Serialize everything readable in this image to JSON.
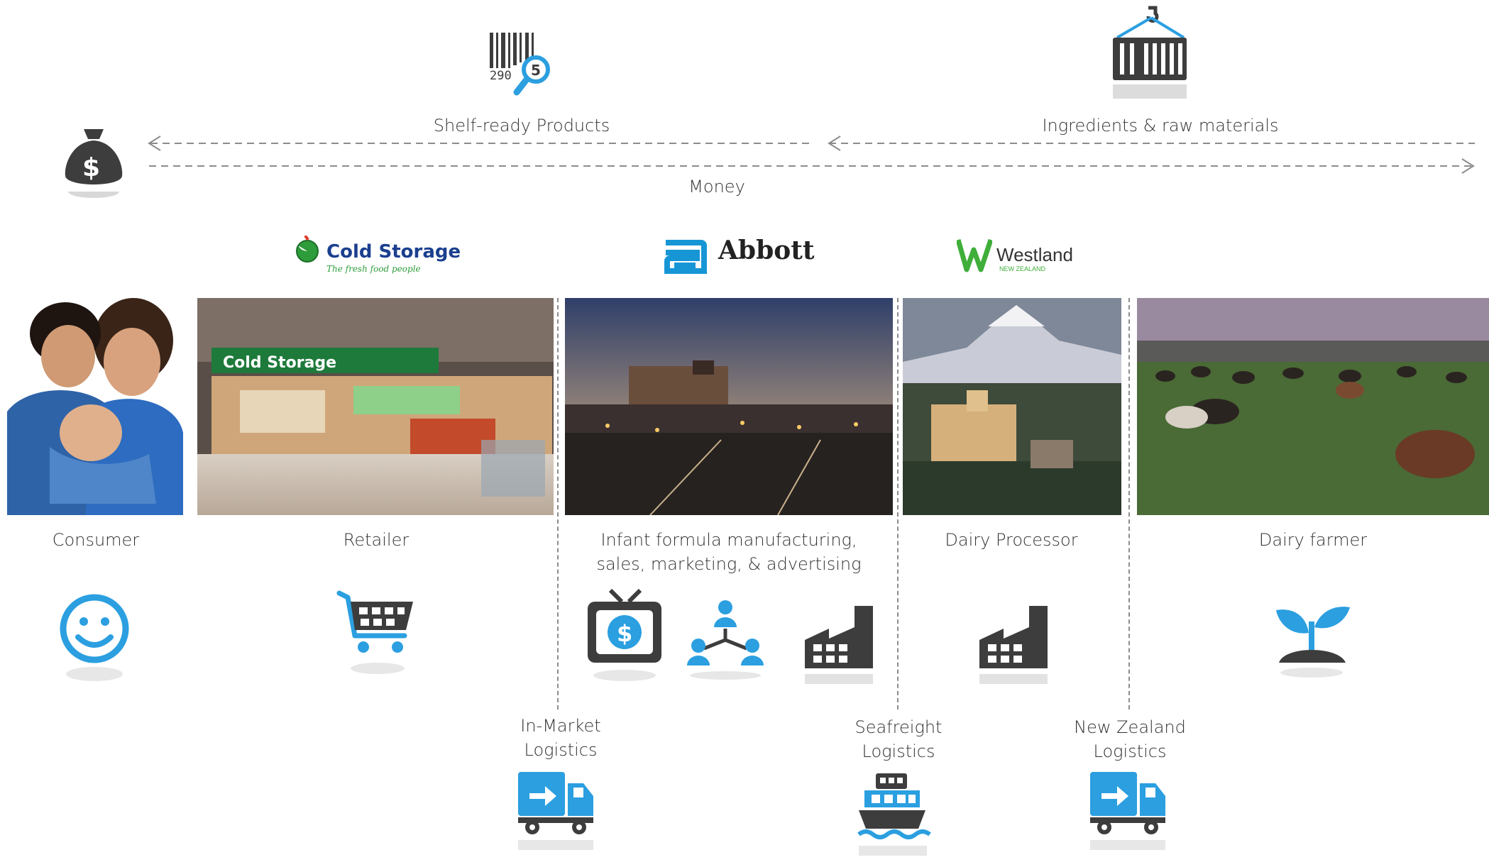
{
  "flows": {
    "products_label": "Shelf-ready Products",
    "materials_label": "Ingredients & raw materials",
    "money_label": "Money"
  },
  "logos": {
    "retailer_name": "Cold Storage",
    "retailer_tagline": "The fresh food people",
    "manufacturer_name": "Abbott",
    "processor_name": "Westland",
    "processor_sub": "NEW ZEALAND"
  },
  "stages": [
    {
      "label": "Consumer"
    },
    {
      "label": "Retailer"
    },
    {
      "label_line1": "Infant formula manufacturing,",
      "label_line2": "sales, marketing, & advertising"
    },
    {
      "label": "Dairy Processor"
    },
    {
      "label": "Dairy farmer"
    }
  ],
  "logistics": [
    {
      "line1": "In-Market",
      "line2": "Logistics"
    },
    {
      "line1": "Seafreight",
      "line2": "Logistics"
    },
    {
      "line1": "New Zealand",
      "line2": "Logistics"
    }
  ],
  "barcode_digits": "290",
  "barcode_magnifier_digit": "5",
  "colors": {
    "accent_blue": "#2b9fe0",
    "icon_dark": "#3d3d3d",
    "dashed_line": "#8c8c8c",
    "cold_storage_navy": "#1b3f8f",
    "cold_storage_green": "#2e9c3a",
    "westland_green": "#3fae3a",
    "abbott_blue": "#1796d6"
  },
  "icons": [
    "barcode-icon",
    "shipping-container-icon",
    "money-bag-icon",
    "smiley-icon",
    "shopping-cart-icon",
    "tv-dollar-icon",
    "org-chart-icon",
    "factory-icon",
    "sprout-icon",
    "delivery-truck-icon",
    "cargo-ship-icon"
  ]
}
